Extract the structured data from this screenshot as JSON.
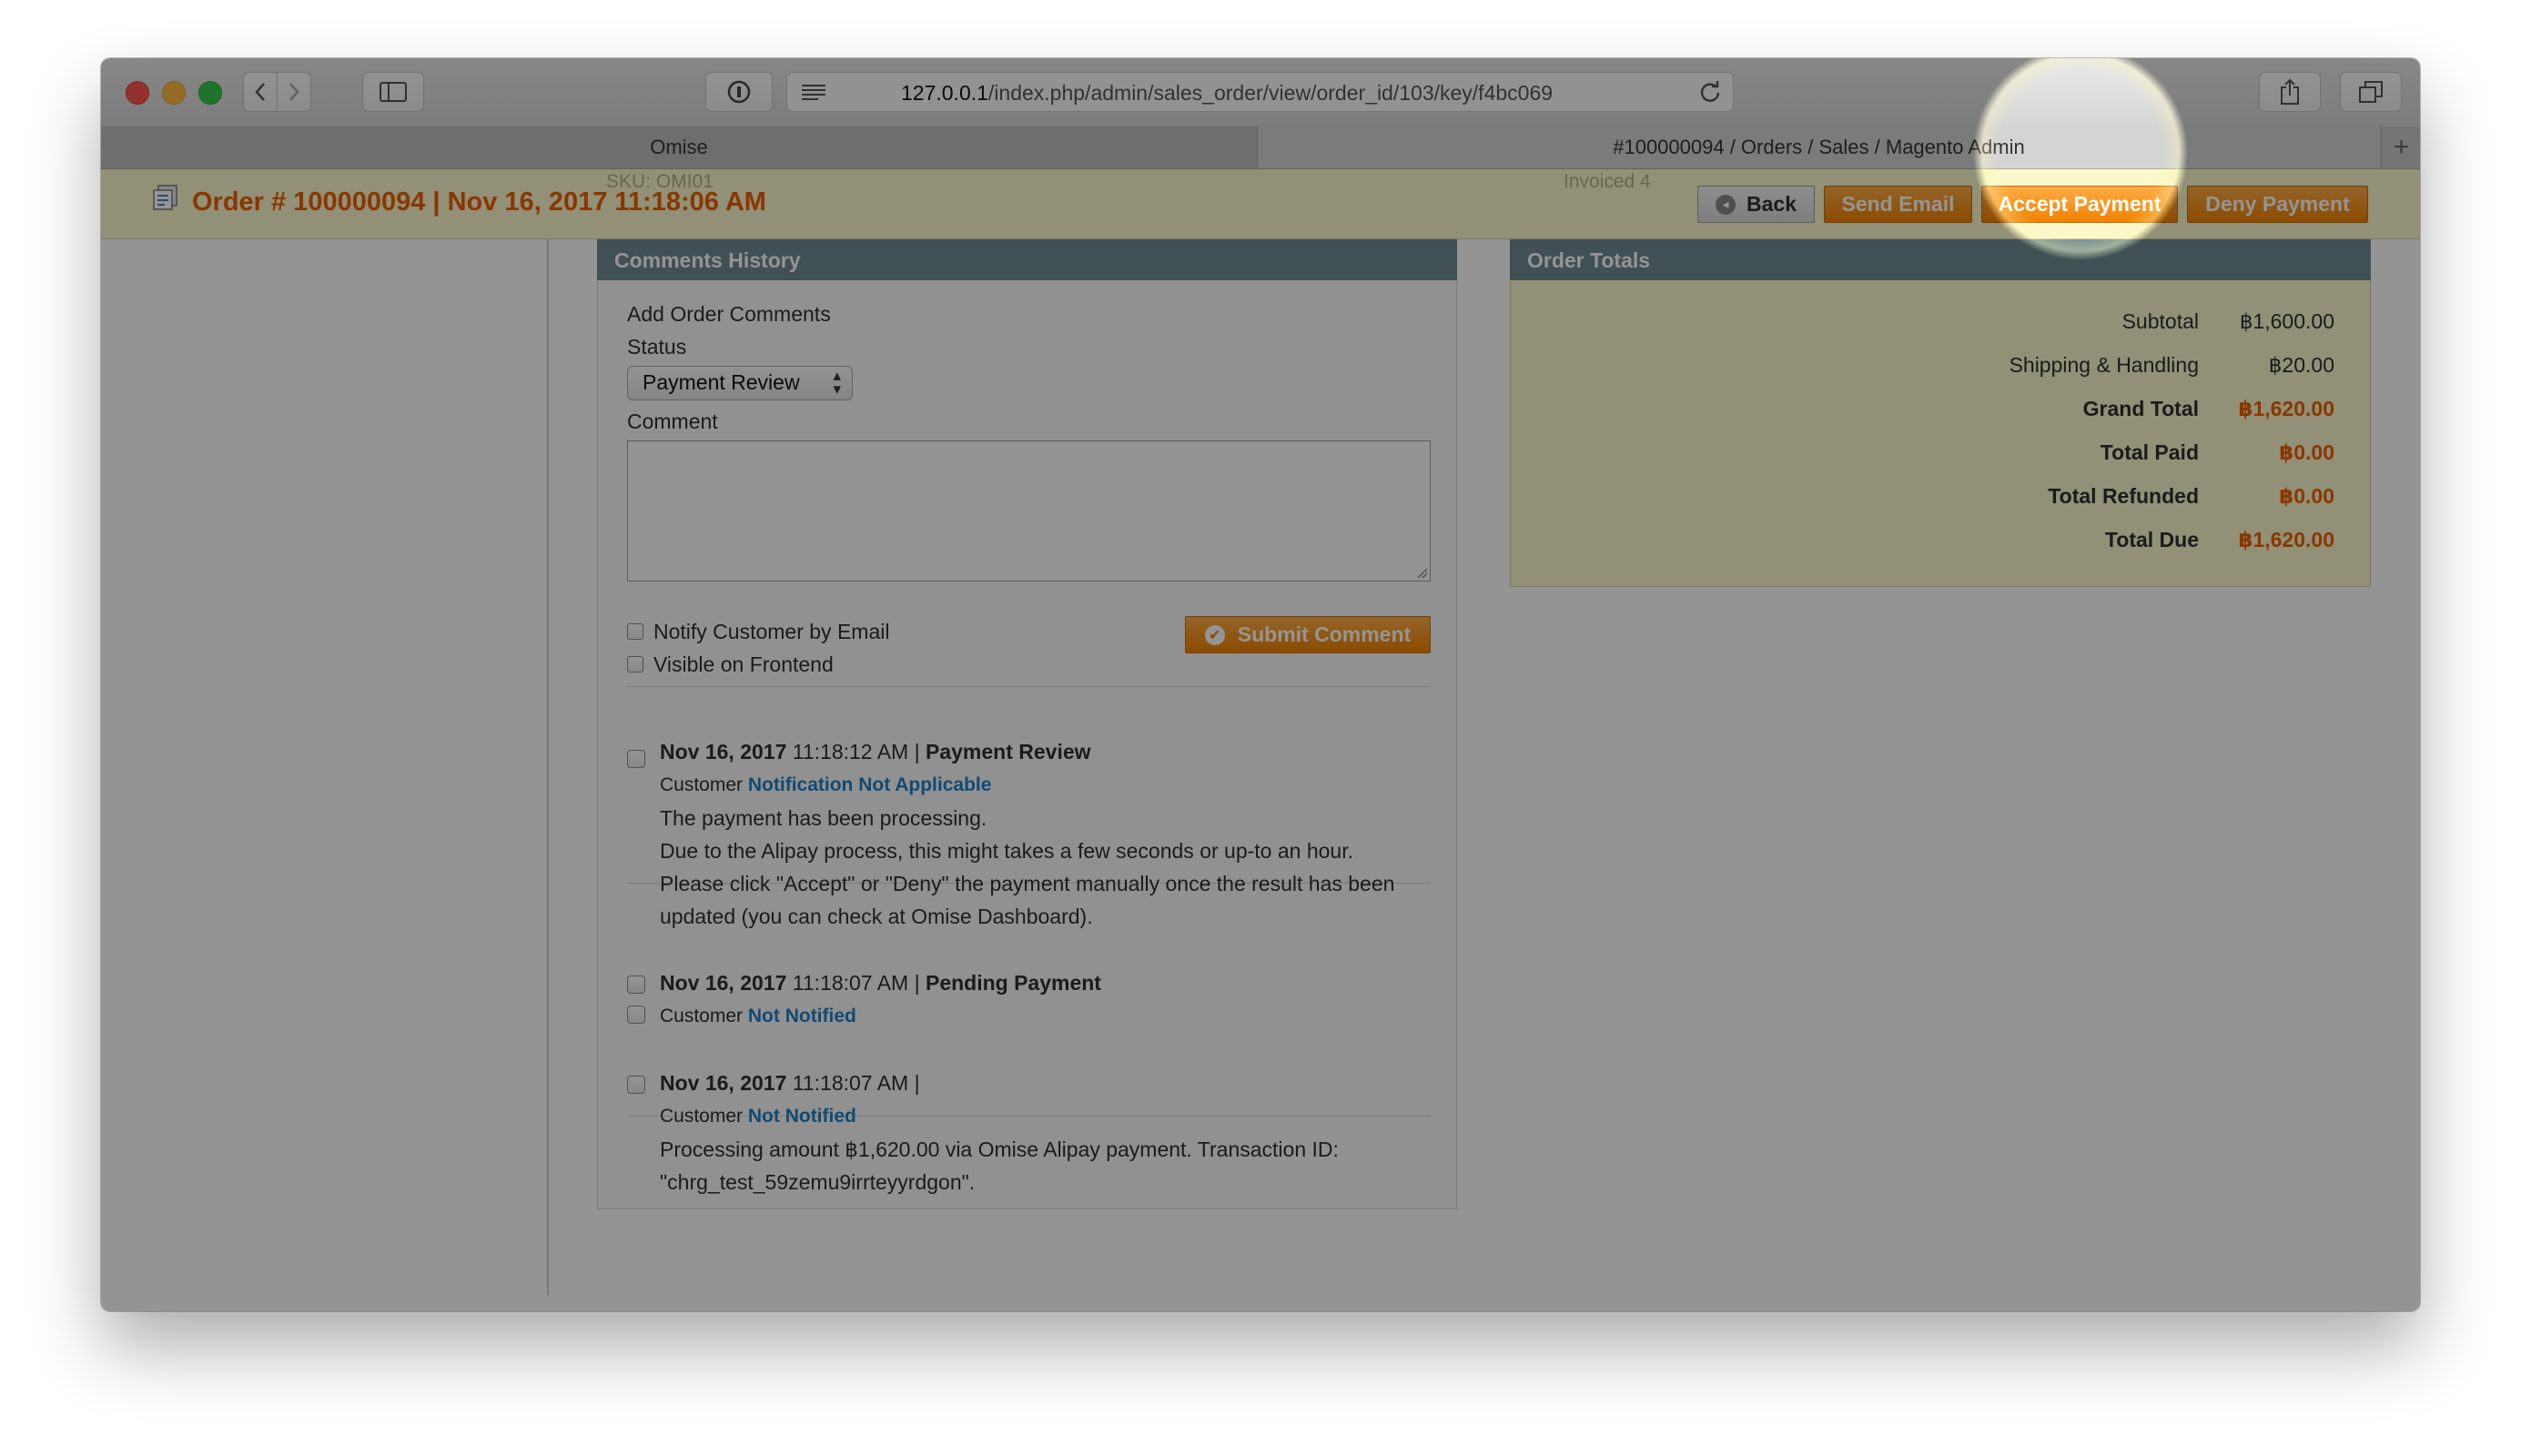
{
  "browser": {
    "url_host": "127.0.0.1",
    "url_path": "/index.php/admin/sales_order/view/order_id/103/key/f4bc069",
    "tabs": [
      {
        "label": "Omise"
      },
      {
        "label": "#100000094 / Orders / Sales / Magento Admin"
      }
    ],
    "new_tab_label": "+"
  },
  "header": {
    "title": "Order # 100000094 | Nov 16, 2017 11:18:06 AM",
    "ghost_sku": "SKU: OMI01",
    "ghost_invoiced": "Invoiced  4",
    "buttons": {
      "back": "Back",
      "send_email": "Send Email",
      "accept_payment": "Accept Payment",
      "deny_payment": "Deny Payment"
    }
  },
  "comments": {
    "panel_title": "Comments History",
    "add_label": "Add Order Comments",
    "status_label": "Status",
    "status_value": "Payment Review",
    "comment_label": "Comment",
    "comment_value": "",
    "notify_label": "Notify Customer by Email",
    "visible_label": "Visible on Frontend",
    "submit_label": "Submit Comment",
    "history": [
      {
        "date": "Nov 16, 2017",
        "time": "11:18:12 AM",
        "sep": "|",
        "status": "Payment Review",
        "customer_label": "Customer",
        "notification": "Notification Not Applicable",
        "lines": [
          "The payment has been processing.",
          "Due to the Alipay process, this might takes a few seconds or up-to an hour.",
          "Please click \"Accept\" or \"Deny\" the payment manually once the result has been",
          "updated (you can check at Omise Dashboard)."
        ]
      },
      {
        "date": "Nov 16, 2017",
        "time": "11:18:07 AM",
        "sep": "|",
        "status": "Pending Payment",
        "customer_label": "Customer",
        "notification": "Not Notified",
        "lines": []
      },
      {
        "date": "Nov 16, 2017",
        "time": "11:18:07 AM",
        "sep": "|",
        "status": "",
        "customer_label": "Customer",
        "notification": "Not Notified",
        "lines": [
          "Processing amount ฿1,620.00 via Omise Alipay payment. Transaction ID:",
          "\"chrg_test_59zemu9irrteyyrdgon\"."
        ]
      }
    ]
  },
  "totals": {
    "panel_title": "Order Totals",
    "rows": [
      {
        "label": "Subtotal",
        "value": "฿1,600.00"
      },
      {
        "label": "Shipping & Handling",
        "value": "฿20.00"
      },
      {
        "label": "Grand Total",
        "value": "฿1,620.00"
      },
      {
        "label": "Total Paid",
        "value": "฿0.00"
      },
      {
        "label": "Total Refunded",
        "value": "฿0.00"
      },
      {
        "label": "Total Due",
        "value": "฿1,620.00"
      }
    ]
  },
  "colors": {
    "accent_orange": "#eb5e00",
    "button_orange": "#f18200",
    "panel_header": "#6f8992",
    "header_bar": "#fbf8cb",
    "link_blue": "#1e7ec8"
  },
  "icons": {
    "reader": "reader-icon",
    "reload": "reload-icon",
    "share": "share-icon",
    "tabs": "tabs-overview-icon",
    "sidebar": "sidebar-icon",
    "info": "info-icon",
    "order": "order-icon",
    "back": "back-arrow-icon",
    "submit": "check-circle-icon"
  }
}
